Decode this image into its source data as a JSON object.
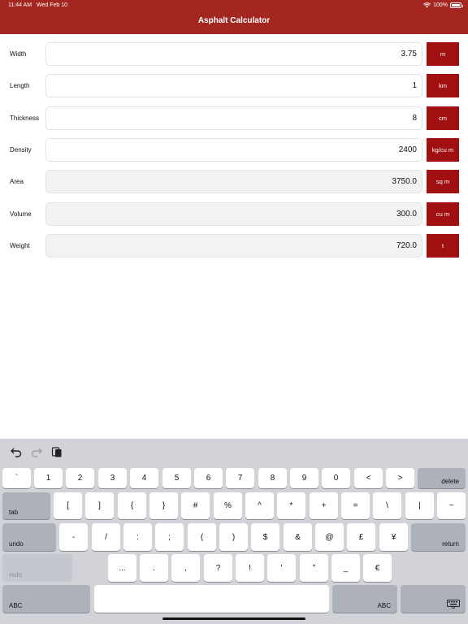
{
  "status": {
    "time": "11:44 AM",
    "date": "Wed Feb 10",
    "battery": "100%"
  },
  "nav": {
    "title": "Asphalt Calculator"
  },
  "rows": [
    {
      "label": "Width",
      "value": "3.75",
      "unit": "m"
    },
    {
      "label": "Length",
      "value": "1",
      "unit": "km"
    },
    {
      "label": "Thickness",
      "value": "8",
      "unit": "cm"
    },
    {
      "label": "Density",
      "value": "2400",
      "unit": "kg/cu m"
    },
    {
      "label": "Area",
      "value": "3750.0",
      "unit": "sq m"
    },
    {
      "label": "Volume",
      "value": "300.0",
      "unit": "cu m"
    },
    {
      "label": "Weight",
      "value": "720.0",
      "unit": "t"
    }
  ],
  "keyboard": {
    "row1": [
      "`",
      "1",
      "2",
      "3",
      "4",
      "5",
      "6",
      "7",
      "8",
      "9",
      "0",
      "<",
      ">"
    ],
    "delete": "delete",
    "tab": "tab",
    "row2": [
      "[",
      "]",
      "{",
      "}",
      "#",
      "%",
      "^",
      "*",
      "+",
      "=",
      "\\",
      "|",
      "~"
    ],
    "undo": "undo",
    "row3": [
      "-",
      "/",
      ":",
      ";",
      "(",
      ")",
      "$",
      "&",
      "@",
      "£",
      "¥"
    ],
    "return": "return",
    "redo": "redo",
    "row4": [
      "...",
      ".",
      ",",
      "?",
      "!",
      "'",
      "”",
      "_",
      "€"
    ],
    "abc_left": "ABC",
    "abc_right": "ABC"
  },
  "icons": {
    "undo": "undo-arrow-icon",
    "redo": "redo-arrow-icon",
    "paste": "clipboard-icon",
    "dismiss": "keyboard-dismiss-icon"
  },
  "colors": {
    "nav": "#a32620",
    "unit_button": "#a01010",
    "keyboard_bg": "#d1d3d9"
  }
}
